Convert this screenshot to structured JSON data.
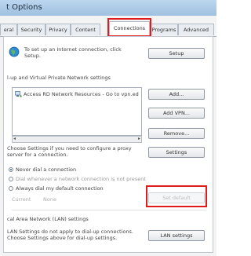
{
  "window": {
    "title": "t Options"
  },
  "tabs": [
    {
      "label": "eral"
    },
    {
      "label": "Security"
    },
    {
      "label": "Privacy"
    },
    {
      "label": "Content"
    },
    {
      "label": "Connections"
    },
    {
      "label": "Programs"
    },
    {
      "label": "Advanced"
    }
  ],
  "setup": {
    "text": "To set up an Internet connection, click Setup.",
    "button": "Setup"
  },
  "dialup_section": {
    "title": "l-up and Virtual Private Network settings",
    "list_item": "Access RD Network Resources - Go to vpn.ed",
    "add_button": "Add...",
    "add_vpn_button": "Add VPN...",
    "remove_button": "Remove...",
    "settings_text": "Choose Settings if you need to configure a proxy server for a connection.",
    "settings_button": "Settings"
  },
  "dial_options": [
    {
      "label": "Never dial a connection",
      "selected": true
    },
    {
      "label": "Dial whenever a network connection is not present",
      "selected": false
    },
    {
      "label": "Always dial my default connection",
      "selected": false
    }
  ],
  "current": {
    "label": "Current",
    "value": "None"
  },
  "set_default_button": "Set default",
  "lan_section": {
    "title": "cal Area Network (LAN) settings",
    "text": "LAN Settings do not apply to dial-up connections. Choose Settings above for dial-up settings.",
    "button": "LAN settings"
  },
  "colors": {
    "highlight": "#e01b1b",
    "accent": "#2b5fa8"
  }
}
